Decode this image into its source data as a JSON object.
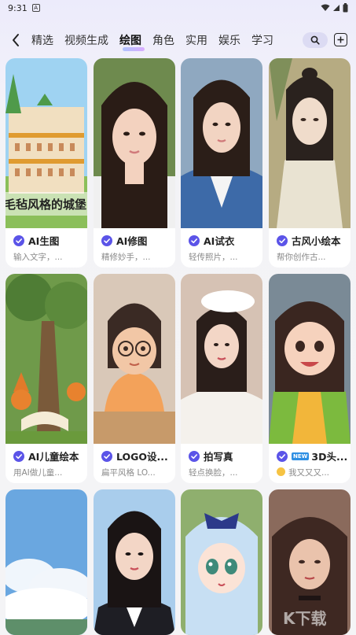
{
  "status_bar": {
    "time": "9:31",
    "mini_label": "A"
  },
  "nav": {
    "tabs": [
      "精选",
      "视频生成",
      "绘图",
      "角色",
      "实用",
      "娱乐",
      "学习"
    ],
    "active_tab": "绘图"
  },
  "cards": [
    {
      "title": "AI生图",
      "subtitle": "输入文字，...",
      "overlay": "毛毡风格的城堡"
    },
    {
      "title": "AI修图",
      "subtitle": "精修妙手，..."
    },
    {
      "title": "AI试衣",
      "subtitle": "轻传照片，..."
    },
    {
      "title": "古风小绘本",
      "subtitle": "帮你创作古..."
    },
    {
      "title": "AI儿童绘本",
      "subtitle": "用AI做儿童..."
    },
    {
      "title": "LOGO设...",
      "subtitle": "扁平风格 LO..."
    },
    {
      "title": "拍写真",
      "subtitle": "轻点换脸，..."
    },
    {
      "title": "3D头...",
      "subtitle": "我又又又...",
      "new_badge": "NEW"
    }
  ],
  "watermark": "K下载",
  "colors": {
    "accent": "#5b54e8",
    "tab_gradient_start": "#9fb8ff",
    "tab_gradient_end": "#d49bff"
  }
}
